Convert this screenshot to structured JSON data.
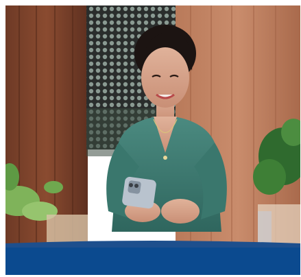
{
  "photo": {
    "subject": "woman-using-smartphone"
  },
  "colors": {
    "banner": "#0b4a8f",
    "table": "#1d4f8d",
    "blouse": "#3f7f75",
    "wood": "#9a5a3c"
  }
}
